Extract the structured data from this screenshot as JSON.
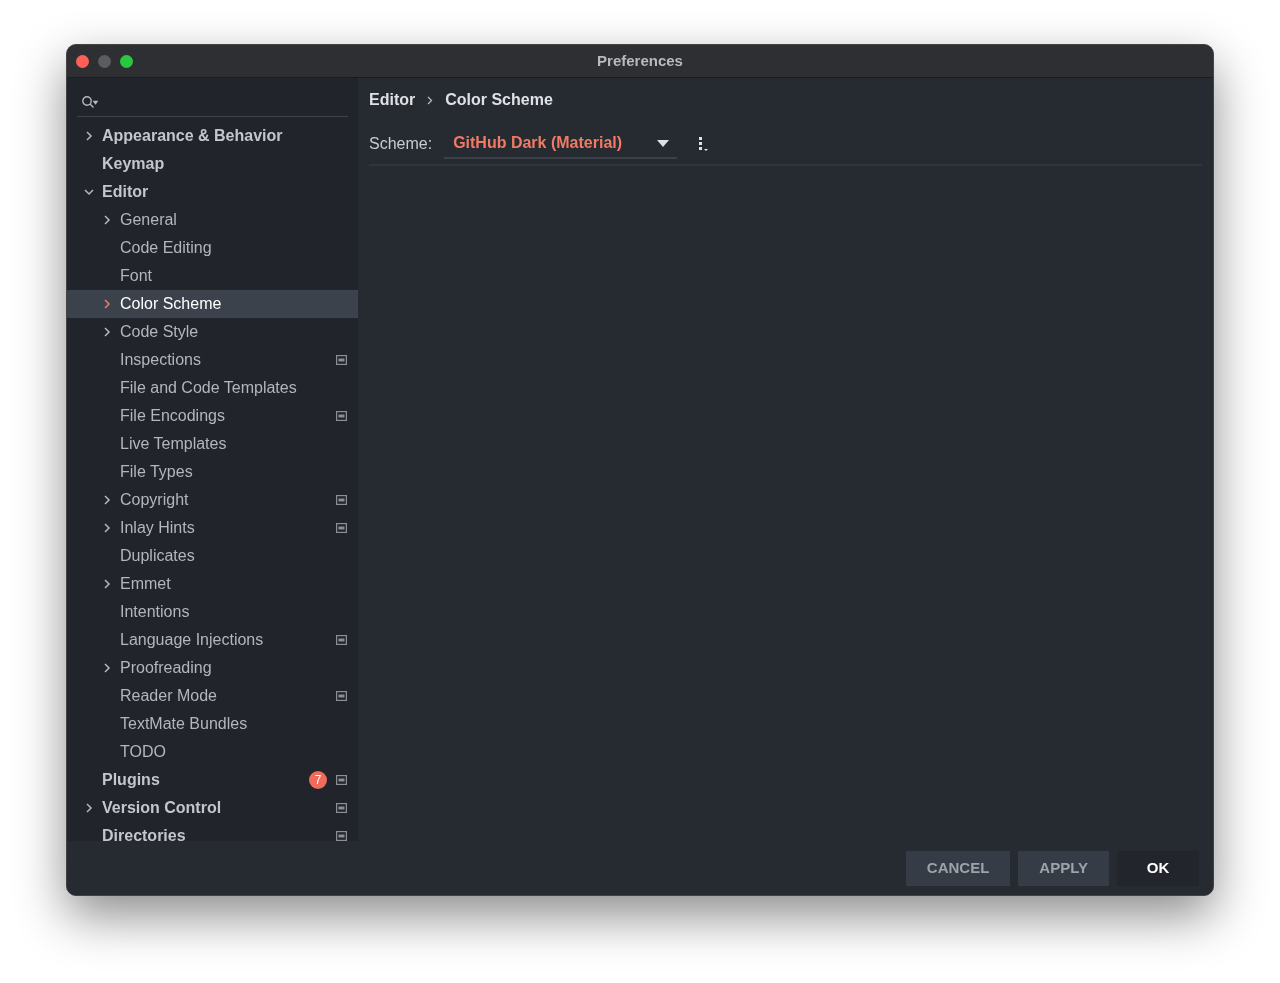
{
  "window": {
    "title": "Preferences"
  },
  "tree": [
    {
      "label": "Appearance & Behavior",
      "selected": false,
      "expanded": false
    },
    {
      "label": "Keymap",
      "selected": false
    },
    {
      "label": "Editor",
      "selected": false,
      "expanded": true,
      "children": [
        {
          "label": "General",
          "selected": false,
          "expanded": false
        },
        {
          "label": "Code Editing",
          "selected": false
        },
        {
          "label": "Font",
          "selected": false
        },
        {
          "label": "Color Scheme",
          "selected": true,
          "expanded": false
        },
        {
          "label": "Code Style",
          "selected": false,
          "expanded": false
        },
        {
          "label": "Inspections",
          "selected": false,
          "project_setting": true
        },
        {
          "label": "File and Code Templates",
          "selected": false
        },
        {
          "label": "File Encodings",
          "selected": false,
          "project_setting": true
        },
        {
          "label": "Live Templates",
          "selected": false
        },
        {
          "label": "File Types",
          "selected": false
        },
        {
          "label": "Copyright",
          "selected": false,
          "expanded": false,
          "project_setting": true
        },
        {
          "label": "Inlay Hints",
          "selected": false,
          "expanded": false,
          "project_setting": true
        },
        {
          "label": "Duplicates",
          "selected": false
        },
        {
          "label": "Emmet",
          "selected": false,
          "expanded": false
        },
        {
          "label": "Intentions",
          "selected": false
        },
        {
          "label": "Language Injections",
          "selected": false,
          "project_setting": true
        },
        {
          "label": "Proofreading",
          "selected": false,
          "expanded": false
        },
        {
          "label": "Reader Mode",
          "selected": false,
          "project_setting": true
        },
        {
          "label": "TextMate Bundles",
          "selected": false
        },
        {
          "label": "TODO",
          "selected": false
        }
      ]
    },
    {
      "label": "Plugins",
      "selected": false,
      "badge": "7",
      "project_setting": true
    },
    {
      "label": "Version Control",
      "selected": false,
      "expanded": false,
      "project_setting": true
    },
    {
      "label": "Directories",
      "selected": false,
      "project_setting": true
    }
  ],
  "breadcrumb": [
    "Editor",
    "Color Scheme"
  ],
  "scheme": {
    "label": "Scheme:",
    "value": "GitHub Dark (Material)"
  },
  "buttons": [
    {
      "label": "CANCEL",
      "kind": "secondary"
    },
    {
      "label": "APPLY",
      "kind": "secondary"
    },
    {
      "label": "OK",
      "kind": "default"
    }
  ]
}
